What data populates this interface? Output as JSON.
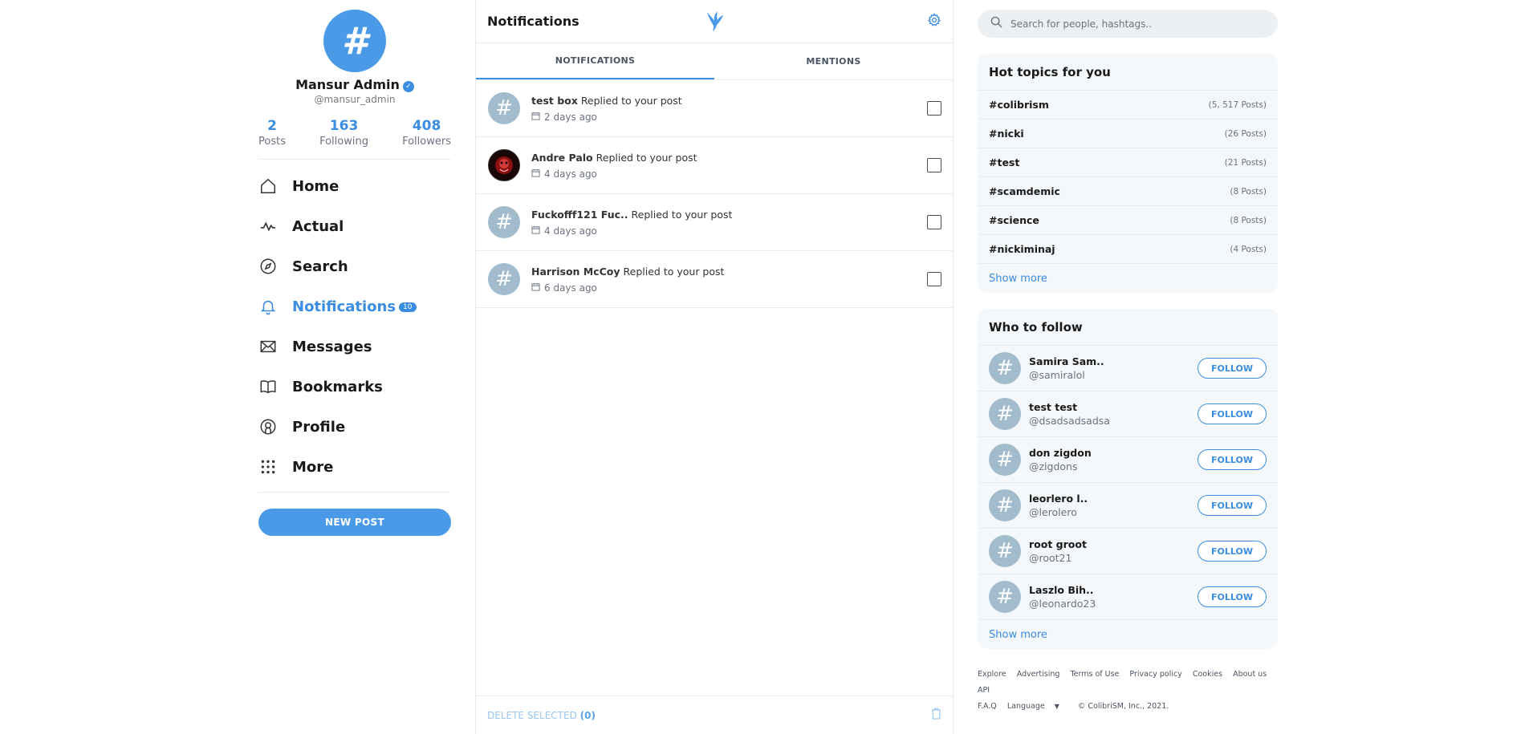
{
  "profile": {
    "avatar_glyph": "#",
    "name": "Mansur Admin",
    "verified_mark": "✓",
    "handle": "@mansur_admin",
    "stats": [
      {
        "value": "2",
        "label": "Posts"
      },
      {
        "value": "163",
        "label": "Following"
      },
      {
        "value": "408",
        "label": "Followers"
      }
    ]
  },
  "nav": {
    "items": [
      {
        "label": "Home",
        "icon": "home-icon"
      },
      {
        "label": "Actual",
        "icon": "activity-icon"
      },
      {
        "label": "Search",
        "icon": "compass-icon"
      },
      {
        "label": "Notifications",
        "icon": "bell-icon",
        "badge": "10",
        "active": true
      },
      {
        "label": "Messages",
        "icon": "envelope-icon"
      },
      {
        "label": "Bookmarks",
        "icon": "book-icon"
      },
      {
        "label": "Profile",
        "icon": "user-circle-icon"
      },
      {
        "label": "More",
        "icon": "grid-dots-icon"
      }
    ],
    "new_post_label": "NEW POST"
  },
  "center": {
    "title": "Notifications",
    "tabs": [
      {
        "label": "NOTIFICATIONS",
        "active": true
      },
      {
        "label": "MENTIONS",
        "active": false
      }
    ],
    "notifications": [
      {
        "user": "test box",
        "action": "Replied to your post",
        "time": "2 days ago"
      },
      {
        "user": "Andre Palo",
        "action": "Replied to your post",
        "time": "4 days ago"
      },
      {
        "user": "Fuckofff121 Fuc..",
        "action": "Replied to your post",
        "time": "4 days ago"
      },
      {
        "user": "Harrison McCoy",
        "action": "Replied to your post",
        "time": "6 days ago"
      }
    ],
    "delete_label": "DELETE SELECTED",
    "delete_count": "(0)"
  },
  "right": {
    "search_placeholder": "Search for people, hashtags..",
    "hot_topics_title": "Hot topics for you",
    "topics": [
      {
        "tag": "#colibrism",
        "count": "(5, 517 Posts)"
      },
      {
        "tag": "#nicki",
        "count": "(26 Posts)"
      },
      {
        "tag": "#test",
        "count": "(21 Posts)"
      },
      {
        "tag": "#scamdemic",
        "count": "(8 Posts)"
      },
      {
        "tag": "#science",
        "count": "(8 Posts)"
      },
      {
        "tag": "#nickiminaj",
        "count": "(4 Posts)"
      }
    ],
    "show_more_label": "Show more",
    "who_to_follow_title": "Who to follow",
    "follow": [
      {
        "name": "Samira Sam..",
        "handle": "@samiralol"
      },
      {
        "name": "test test",
        "handle": "@dsadsadsadsa"
      },
      {
        "name": "don zigdon",
        "handle": "@zigdons"
      },
      {
        "name": "leorlero l..",
        "handle": "@lerolero"
      },
      {
        "name": "root groot",
        "handle": "@root21"
      },
      {
        "name": "Laszlo Bih..",
        "handle": "@leonardo23"
      }
    ],
    "follow_button_label": "FOLLOW",
    "footer_links": [
      "Explore",
      "Advertising",
      "Terms of Use",
      "Privacy policy",
      "Cookies",
      "About us",
      "API",
      "F.A.Q"
    ],
    "language_label": "Language",
    "copyright": "© ColibriSM, Inc., 2021."
  },
  "colors": {
    "accent": "#3a8de0",
    "avatar_placeholder": "#a2bccd",
    "panel_bg": "#f5f8fa"
  }
}
